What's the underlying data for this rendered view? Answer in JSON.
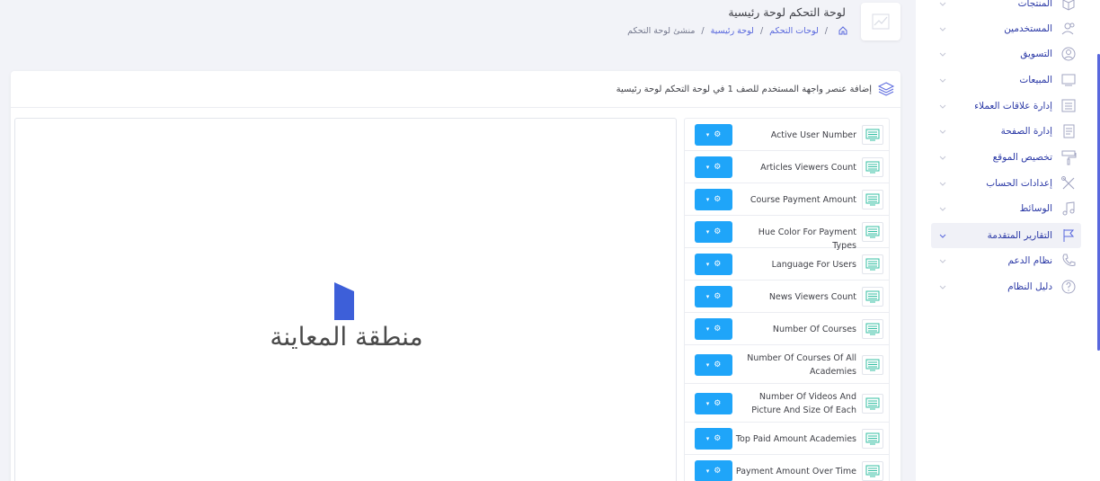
{
  "header": {
    "title": "لوحة التحكم لوحة رئيسية",
    "breadcrumb": [
      "لوحات التحكم",
      "لوحة رئيسية",
      "منشئ لوحة التحكم"
    ]
  },
  "sidebar": {
    "items": [
      {
        "label": "المنتجات",
        "icon": "box-icon"
      },
      {
        "label": "المستخدمين",
        "icon": "users-icon"
      },
      {
        "label": "التسويق",
        "icon": "marketing-icon"
      },
      {
        "label": "المبيعات",
        "icon": "sales-icon"
      },
      {
        "label": "إدارة علاقات العملاء",
        "icon": "crm-icon"
      },
      {
        "label": "إدارة الصفحة",
        "icon": "page-icon"
      },
      {
        "label": "تخصيص الموقع",
        "icon": "paint-roller-icon"
      },
      {
        "label": "إعدادات الحساب",
        "icon": "tools-icon"
      },
      {
        "label": "الوسائط",
        "icon": "music-icon"
      },
      {
        "label": "التقارير المتقدمة",
        "icon": "flag-icon",
        "active": true
      },
      {
        "label": "نظام الدعم",
        "icon": "phone-icon"
      },
      {
        "label": "دليل النظام",
        "icon": "help-icon"
      }
    ]
  },
  "card": {
    "title": "إضافة عنصر واجهة المستخدم للصف 1 في لوحة التحكم لوحة رئيسية"
  },
  "preview": {
    "text": "منطقة المعاينة",
    "logo_color": "#3d5fd9"
  },
  "widgets": [
    {
      "name": "Active User Number"
    },
    {
      "name": "Articles Viewers Count"
    },
    {
      "name": "Course Payment Amount"
    },
    {
      "name": "Hue Color For Payment Types"
    },
    {
      "name": "Language For Users"
    },
    {
      "name": "News Viewers Count"
    },
    {
      "name": "Number Of Courses"
    },
    {
      "name": "Number Of Courses Of All Academies"
    },
    {
      "name": "Number Of Videos And Picture And Size Of Each"
    },
    {
      "name": "Top Paid Amount Academies"
    },
    {
      "name": "Payment Amount Over Time"
    }
  ],
  "colors": {
    "accent": "#1fa5f9",
    "nav_text": "#2b39a6",
    "link": "#5867dd"
  }
}
